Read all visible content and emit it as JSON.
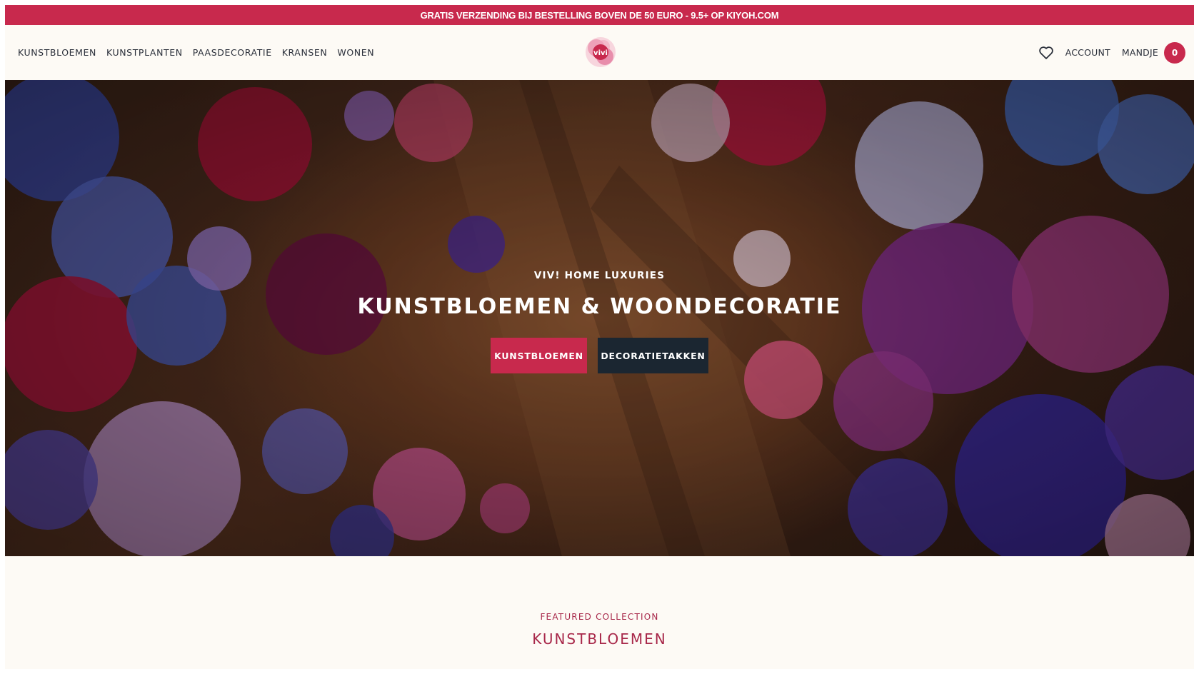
{
  "announcement": "GRATIS VERZENDING BIJ BESTELLING BOVEN DE 50 EURO - 9.5+ OP KIYOH.COM",
  "nav": {
    "items": [
      "KUNSTBLOEMEN",
      "KUNSTPLANTEN",
      "PAASDECORATIE",
      "KRANSEN",
      "WONEN"
    ]
  },
  "logo": {
    "text": "vivi"
  },
  "header_right": {
    "account_label": "ACCOUNT",
    "cart_label": "MANDJE",
    "cart_count": "0"
  },
  "hero": {
    "kicker": "VIV! HOME LUXURIES",
    "headline": "KUNSTBLOEMEN & WOONDECORATIE",
    "primary_button": "KUNSTBLOEMEN",
    "secondary_button": "DECORATIETAKKEN"
  },
  "featured": {
    "kicker": "FEATURED COLLECTION",
    "title": "KUNSTBLOEMEN"
  },
  "colors": {
    "brand": "#c8294d",
    "dark_button": "#1b2631",
    "background": "#fdfaf5",
    "featured_text": "#a8284a"
  },
  "icons": [
    "heart-icon",
    "logo-mark"
  ]
}
